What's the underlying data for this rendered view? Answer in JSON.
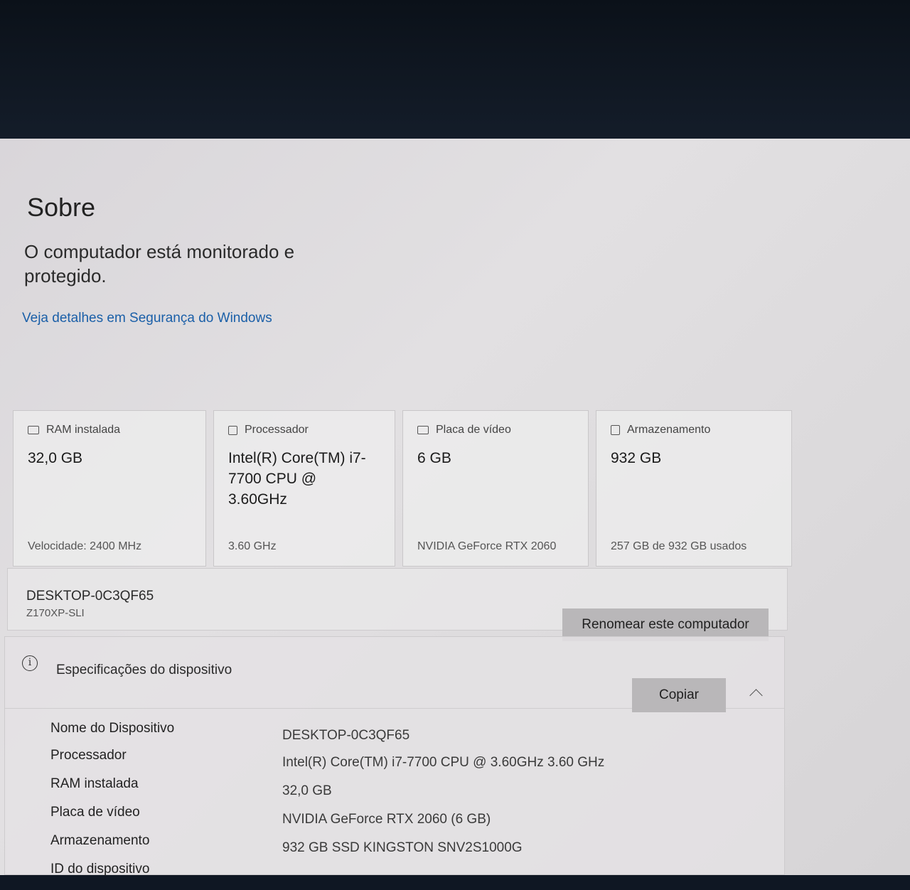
{
  "page": {
    "title": "Sobre"
  },
  "security": {
    "status": "O computador está monitorado e protegido.",
    "link": "Veja detalhes em Segurança do Windows"
  },
  "cards": [
    {
      "label": "RAM instalada",
      "value": "32,0 GB",
      "footer": "Velocidade: 2400 MHz",
      "icon": "ram-icon"
    },
    {
      "label": "Processador",
      "value": "Intel(R) Core(TM) i7-7700 CPU @ 3.60GHz",
      "footer": "3.60 GHz",
      "icon": "processor-icon"
    },
    {
      "label": "Placa de vídeo",
      "value": "6 GB",
      "footer": "NVIDIA GeForce RTX 2060",
      "icon": "gpu-icon"
    },
    {
      "label": "Armazenamento",
      "value": "932 GB",
      "footer": "257 GB de 932 GB usados",
      "icon": "storage-icon"
    }
  ],
  "device": {
    "name": "DESKTOP-0C3QF65",
    "model": "Z170XP-SLI",
    "rename_label": "Renomear este computador"
  },
  "specs": {
    "title": "Especificações do dispositivo",
    "copy_label": "Copiar",
    "rows": [
      {
        "label": "Nome do Dispositivo",
        "value": "DESKTOP-0C3QF65"
      },
      {
        "label": "Processador",
        "value": "Intel(R) Core(TM) i7-7700 CPU @ 3.60GHz   3.60 GHz"
      },
      {
        "label": "RAM instalada",
        "value": "32,0 GB"
      },
      {
        "label": "Placa de vídeo",
        "value": "NVIDIA GeForce RTX 2060 (6 GB)"
      },
      {
        "label": "Armazenamento",
        "value": "932 GB SSD KINGSTON SNV2S1000G"
      },
      {
        "label": "ID do dispositivo",
        "value": ""
      }
    ]
  }
}
